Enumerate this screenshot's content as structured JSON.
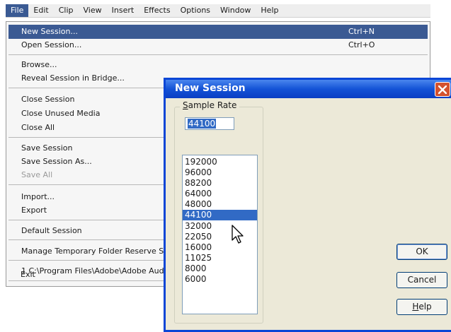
{
  "menubar": {
    "items": [
      "File",
      "Edit",
      "Clip",
      "View",
      "Insert",
      "Effects",
      "Options",
      "Window",
      "Help"
    ],
    "active": "File"
  },
  "file_menu": {
    "new_session": {
      "label": "New Session...",
      "shortcut": "Ctrl+N"
    },
    "open_session": {
      "label": "Open Session...",
      "shortcut": "Ctrl+O"
    },
    "browse": "Browse...",
    "reveal_session": "Reveal Session in Bridge...",
    "close_session": "Close Session",
    "close_unused_media": "Close Unused Media",
    "close_all": "Close All",
    "save_session": "Save Session",
    "save_session_as": "Save Session As...",
    "save_all": "Save All",
    "import": "Import...",
    "export": "Export",
    "default_session": "Default Session",
    "manage_temp_folder": "Manage Temporary Folder Reserve Sp",
    "recent_file": "1 C:\\Program Files\\Adobe\\Adobe Aud",
    "exit": "Exit"
  },
  "dialog": {
    "title": "New Session",
    "group_label_underlined": "S",
    "group_label_rest": "ample Rate",
    "rate_value": "44100",
    "rates": [
      "192000",
      "96000",
      "88200",
      "64000",
      "48000",
      "44100",
      "32000",
      "22050",
      "16000",
      "11025",
      "8000",
      "6000"
    ],
    "selected_rate": "44100",
    "ok_label": "OK",
    "cancel_label": "Cancel",
    "help_underlined": "H",
    "help_rest": "elp"
  },
  "colors": {
    "highlight": "#3b5a93",
    "title_bar": "#1453d6",
    "close_button": "#d4522e",
    "list_selection": "#316ac5"
  }
}
